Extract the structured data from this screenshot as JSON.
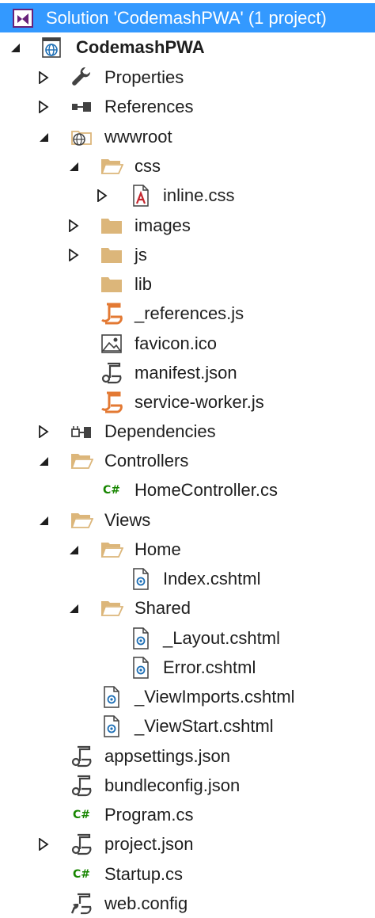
{
  "solution": {
    "label": "Solution 'CodemashPWA' (1 project)",
    "icon": "visual-studio-solution-icon"
  },
  "project": {
    "label": "CodemashPWA",
    "icon": "web-project-globe-icon"
  },
  "items": [
    {
      "label": "Properties",
      "icon": "wrench-icon"
    },
    {
      "label": "References",
      "icon": "references-icon"
    },
    {
      "label": "wwwroot",
      "icon": "globe-folder-icon"
    },
    {
      "label": "css",
      "icon": "folder-open-icon"
    },
    {
      "label": "inline.css",
      "icon": "css-file-icon"
    },
    {
      "label": "images",
      "icon": "folder-icon"
    },
    {
      "label": "js",
      "icon": "folder-icon"
    },
    {
      "label": "lib",
      "icon": "folder-icon"
    },
    {
      "label": "_references.js",
      "icon": "js-file-icon"
    },
    {
      "label": "favicon.ico",
      "icon": "image-file-icon"
    },
    {
      "label": "manifest.json",
      "icon": "json-file-icon"
    },
    {
      "label": "service-worker.js",
      "icon": "js-file-icon"
    },
    {
      "label": "Dependencies",
      "icon": "dependencies-icon"
    },
    {
      "label": "Controllers",
      "icon": "folder-open-icon"
    },
    {
      "label": "HomeController.cs",
      "icon": "csharp-file-icon"
    },
    {
      "label": "Views",
      "icon": "folder-open-icon"
    },
    {
      "label": "Home",
      "icon": "folder-open-icon"
    },
    {
      "label": "Index.cshtml",
      "icon": "razor-file-icon"
    },
    {
      "label": "Shared",
      "icon": "folder-open-icon"
    },
    {
      "label": "_Layout.cshtml",
      "icon": "razor-file-icon"
    },
    {
      "label": "Error.cshtml",
      "icon": "razor-file-icon"
    },
    {
      "label": "_ViewImports.cshtml",
      "icon": "razor-file-icon"
    },
    {
      "label": "_ViewStart.cshtml",
      "icon": "razor-file-icon"
    },
    {
      "label": "appsettings.json",
      "icon": "json-file-icon"
    },
    {
      "label": "bundleconfig.json",
      "icon": "json-file-icon"
    },
    {
      "label": "Program.cs",
      "icon": "csharp-file-icon"
    },
    {
      "label": "project.json",
      "icon": "json-file-icon"
    },
    {
      "label": "Startup.cs",
      "icon": "csharp-file-icon"
    },
    {
      "label": "web.config",
      "icon": "config-file-icon"
    }
  ],
  "csharp_glyph": "C#",
  "colors": {
    "selection": "#3399ff",
    "folder": "#dcb67a",
    "js": "#e37933",
    "csharp": "#178600",
    "razor": "#1e6fb5"
  }
}
